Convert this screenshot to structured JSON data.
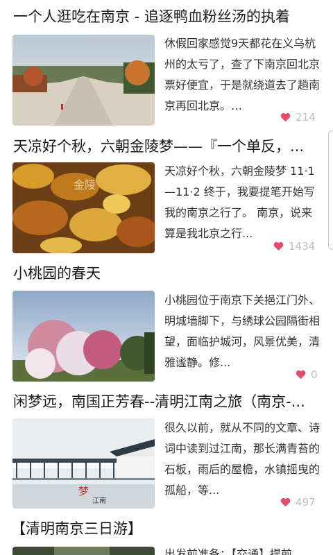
{
  "articles": [
    {
      "title": "一个人逛吃在南京 - 追逐鸭血粉丝汤的执着",
      "excerpt": "休假回家感觉9天都花在义乌杭州的太亏了，查了下南京回北京票好便宜，于是就绕道去了趟南京再回北京。…",
      "likes": "214"
    },
    {
      "title": "天凉好个秋，六朝金陵梦——『一个单反，...",
      "excerpt": "天凉好个秋，六朝金陵梦 11·1—11·2 终于，我要提笔开始写我的南京之行了。 南京，说来算是我北京之行...",
      "likes": "1434"
    },
    {
      "title": "小桃园的春天",
      "excerpt": "小桃园位于南京下关挹江门外、明城墙脚下，与绣球公园隔街相望，面临护城河，风景优美，清雅谧静。修...",
      "likes": "0"
    },
    {
      "title": "闲梦远，南国正芳春--清明江南之旅（南京-...",
      "excerpt": "很久以前，就从不同的文章、诗词中读到过江南，那长满青苔的石板，雨后的屋檐，水镇摇曳的孤船，等...",
      "likes": "497"
    },
    {
      "title": "【清明南京三日游】",
      "excerpt": "出发前准备：【交通】提前",
      "likes": ""
    }
  ],
  "colors": {
    "heart": "#e84a6a",
    "likes_text": "#bdbdbd"
  }
}
